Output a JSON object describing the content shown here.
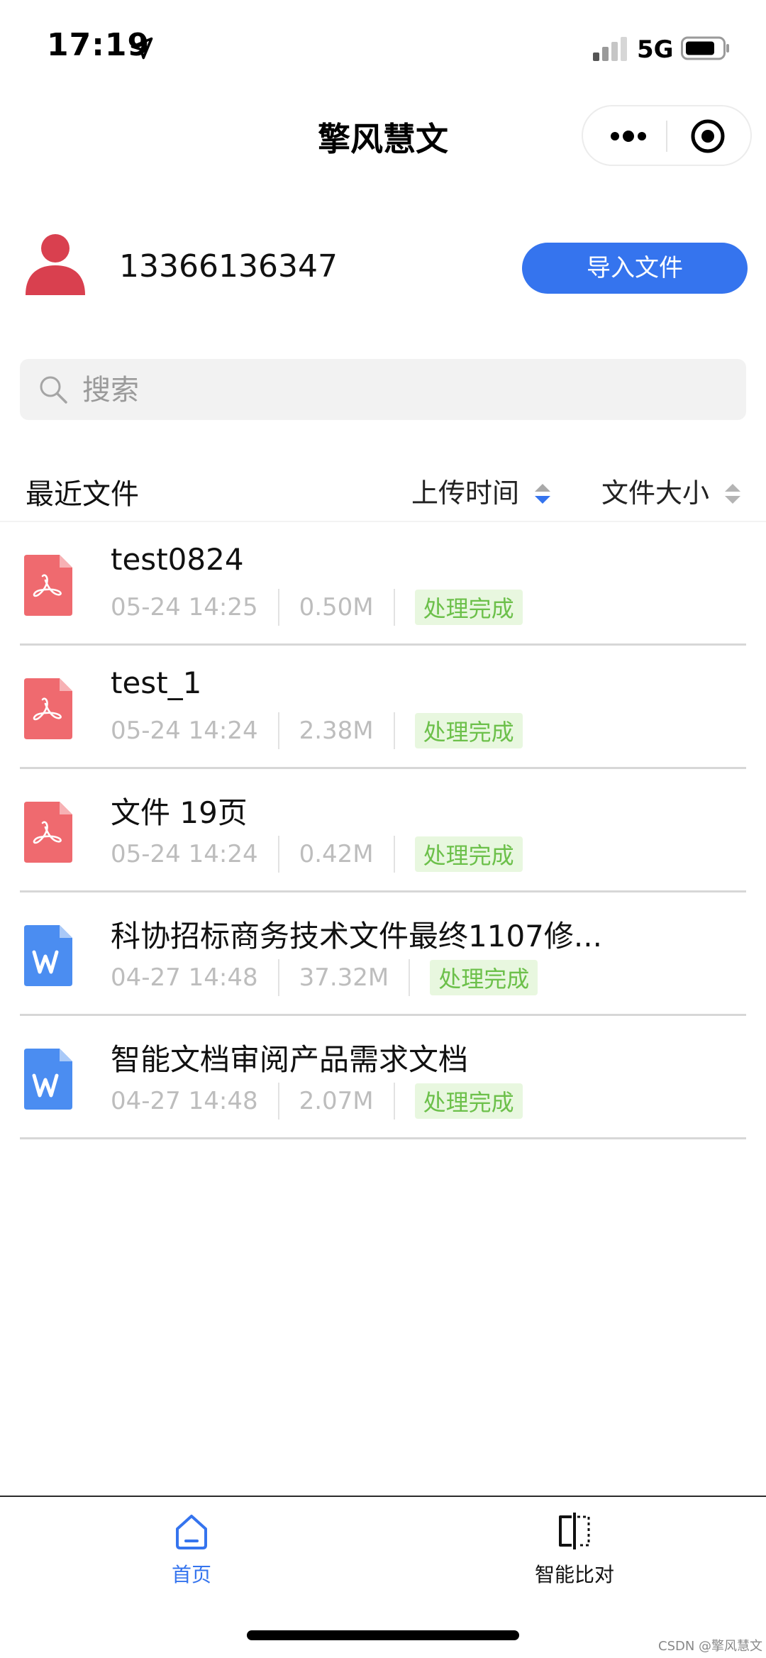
{
  "status_bar": {
    "time": "17:19",
    "network": "5G",
    "icons": [
      "location-arrow-icon",
      "signal-icon",
      "battery-icon"
    ]
  },
  "nav": {
    "title": "擎风慧文",
    "capsule_icons": [
      "more-icon",
      "close-target-icon"
    ]
  },
  "user": {
    "phone": "13366136347",
    "import_label": "导入文件",
    "avatar_color": "#d9404f"
  },
  "search": {
    "placeholder": "搜索"
  },
  "list_header": {
    "title": "最近文件",
    "sort_time_label": "上传时间",
    "sort_size_label": "文件大小"
  },
  "files": [
    {
      "name": "test0824",
      "date": "05-24 14:25",
      "size": "0.50M",
      "status": "处理完成",
      "type": "pdf"
    },
    {
      "name": "test_1",
      "date": "05-24 14:24",
      "size": "2.38M",
      "status": "处理完成",
      "type": "pdf"
    },
    {
      "name": "文件 19页",
      "date": "05-24 14:24",
      "size": "0.42M",
      "status": "处理完成",
      "type": "pdf"
    },
    {
      "name": "科协招标商务技术文件最终1107修...",
      "date": "04-27 14:48",
      "size": "37.32M",
      "status": "处理完成",
      "type": "word"
    },
    {
      "name": "智能文档审阅产品需求文档",
      "date": "04-27 14:48",
      "size": "2.07M",
      "status": "处理完成",
      "type": "word"
    }
  ],
  "tabs": {
    "home_label": "首页",
    "compare_label": "智能比对"
  },
  "watermark": "CSDN @擎风慧文",
  "colors": {
    "accent": "#3574ee",
    "pdf_icon": "#ef6a6f",
    "word_icon": "#4b8df1",
    "status_text": "#6cc04a",
    "status_bg": "#e8f7df"
  }
}
